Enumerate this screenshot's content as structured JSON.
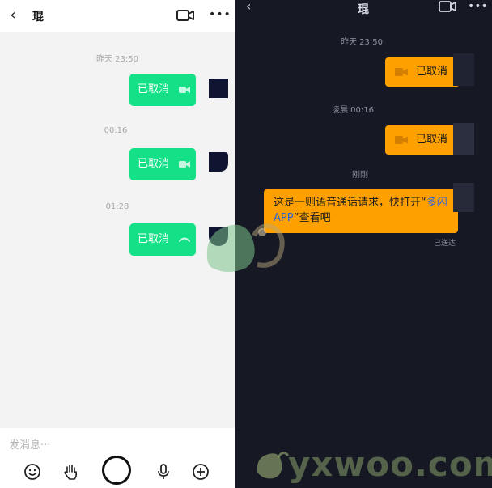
{
  "left_panel": {
    "header": {
      "back_glyph": "‹",
      "title": "琨",
      "video_icon": "video-camera-icon",
      "more_glyph": "•••"
    },
    "messages": [
      {
        "timestamp": "昨天 23:50",
        "text": "已取消",
        "icon": "video-camera-icon"
      },
      {
        "timestamp": "00:16",
        "text": "已取消",
        "icon": "video-camera-icon"
      },
      {
        "timestamp": "01:28",
        "text": "已取消",
        "icon": "phone-icon"
      }
    ],
    "input": {
      "placeholder": "发消息···"
    },
    "toolbar": [
      "emoji-icon",
      "wave-hand-icon",
      "shutter-button",
      "microphone-icon",
      "plus-icon"
    ],
    "bubble_color": "#13e087"
  },
  "right_panel": {
    "header": {
      "back_glyph": "‹",
      "title": "琨",
      "video_icon": "video-camera-icon",
      "more_glyph": "•••"
    },
    "messages": [
      {
        "timestamp": "昨天 23:50",
        "text": "已取消",
        "icon": "video-camera-icon"
      },
      {
        "timestamp": "凌晨 00:16",
        "text": "已取消",
        "icon": "video-camera-icon"
      }
    ],
    "notice": {
      "timestamp": "刚刚",
      "text_before": "这是一则语音通话请求，快打开“",
      "link": "多闪APP",
      "text_after": "”查看吧",
      "status": "已送达"
    },
    "background_color": "#161824",
    "bubble_color": "#fea100",
    "link_color": "#2f63d8"
  },
  "watermark": {
    "text": "yxwoo.com"
  }
}
